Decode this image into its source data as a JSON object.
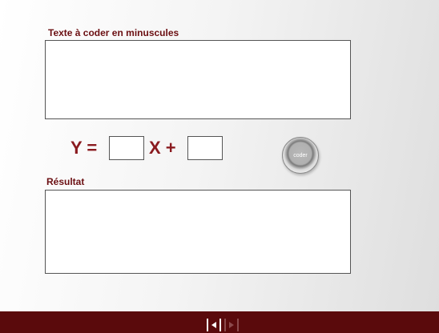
{
  "input_section": {
    "label": "Texte à coder en minuscules",
    "value": ""
  },
  "equation": {
    "y_label": "Y =",
    "x_label": "X +",
    "a_value": "",
    "b_value": ""
  },
  "coder_button": {
    "label": "coder"
  },
  "result_section": {
    "label": "Résultat",
    "value": ""
  },
  "footer": {
    "prev_icon": "triangle-left-bracket-icon",
    "next_icon": "triangle-right-bracket-icon",
    "accent_color": "#5a0a0c"
  }
}
